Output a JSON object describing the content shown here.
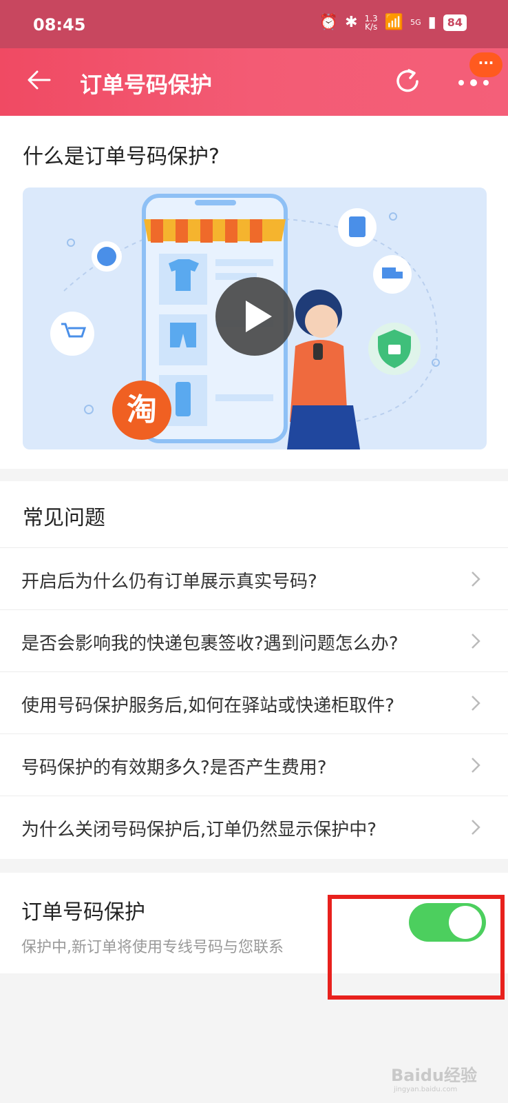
{
  "status_bar": {
    "time": "08:45",
    "net_speed": "1.3",
    "net_unit": "K/s",
    "signal": "5G",
    "battery": "84"
  },
  "header": {
    "title": "订单号码保护",
    "badge": "···"
  },
  "intro": {
    "title": "什么是订单号码保护?",
    "logo_text": "淘"
  },
  "faq": {
    "title": "常见问题",
    "items": [
      "开启后为什么仍有订单展示真实号码?",
      "是否会影响我的快递包裹签收?遇到问题怎么办?",
      "使用号码保护服务后,如何在驿站或快递柜取件?",
      "号码保护的有效期多久?是否产生费用?",
      "为什么关闭号码保护后,订单仍然显示保护中?"
    ]
  },
  "protection": {
    "title": "订单号码保护",
    "description": "保护中,新订单将使用专线号码与您联系",
    "enabled": true
  },
  "watermark": {
    "text": "Baidu经验",
    "sub": "jingyan.baidu.com"
  },
  "colors": {
    "header": "#f04a63",
    "status_bar": "#c8475f",
    "switch_on": "#4ccf5e",
    "highlight": "#e8211d",
    "badge": "#ff5a1f"
  }
}
